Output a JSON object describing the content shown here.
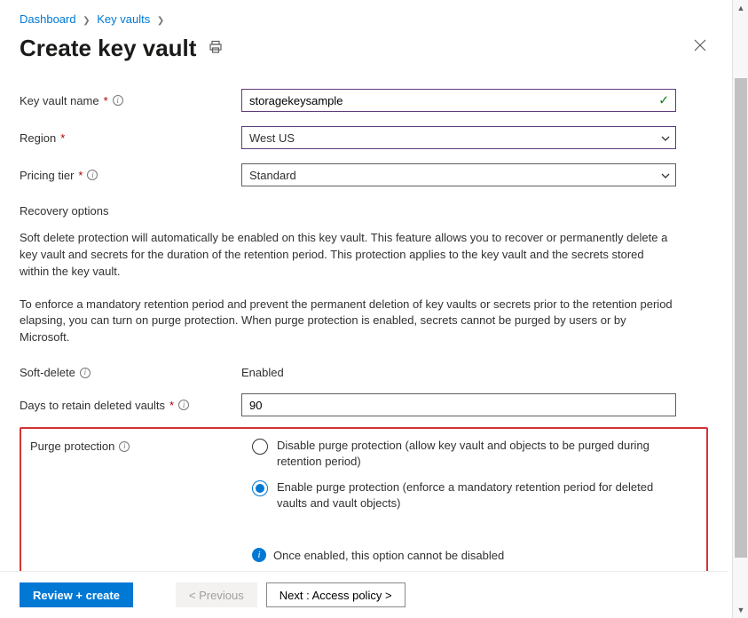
{
  "breadcrumb": {
    "items": [
      "Dashboard",
      "Key vaults"
    ]
  },
  "header": {
    "title": "Create key vault"
  },
  "fields": {
    "name_label": "Key vault name",
    "name_value": "storagekeysample",
    "region_label": "Region",
    "region_value": "West US",
    "tier_label": "Pricing tier",
    "tier_value": "Standard",
    "softdelete_label": "Soft-delete",
    "softdelete_value": "Enabled",
    "retain_label": "Days to retain deleted vaults",
    "retain_value": "90",
    "purge_label": "Purge protection"
  },
  "text": {
    "recovery_heading": "Recovery options",
    "recovery_para1": "Soft delete protection will automatically be enabled on this key vault. This feature allows you to recover or permanently delete a key vault and secrets for the duration of the retention period. This protection applies to the key vault and the secrets stored within the key vault.",
    "recovery_para2": "To enforce a mandatory retention period and prevent the permanent deletion of key vaults or secrets prior to the retention period elapsing, you can turn on purge protection. When purge protection is enabled, secrets cannot be purged by users or by Microsoft."
  },
  "purge": {
    "option_disable": "Disable purge protection (allow key vault and objects to be purged during retention period)",
    "option_enable": "Enable purge protection (enforce a mandatory retention period for deleted vaults and vault objects)",
    "selected": "enable",
    "info_text": "Once enabled, this option cannot be disabled"
  },
  "footer": {
    "review": "Review + create",
    "previous": "< Previous",
    "next": "Next : Access policy >"
  }
}
